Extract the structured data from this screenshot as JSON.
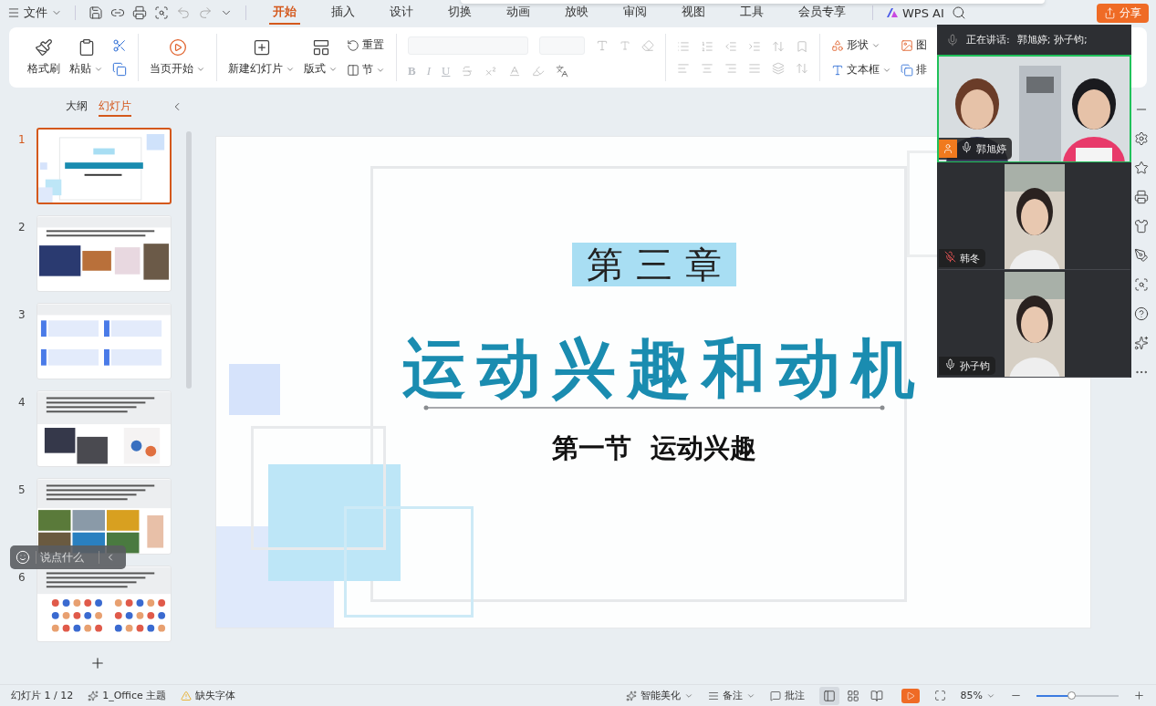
{
  "menu": {
    "label": "文件"
  },
  "ribbon_tabs": [
    {
      "label": "开始",
      "selected": true
    },
    {
      "label": "插入",
      "selected": false
    },
    {
      "label": "设计",
      "selected": false
    },
    {
      "label": "切换",
      "selected": false
    },
    {
      "label": "动画",
      "selected": false
    },
    {
      "label": "放映",
      "selected": false
    },
    {
      "label": "审阅",
      "selected": false
    },
    {
      "label": "视图",
      "selected": false
    },
    {
      "label": "工具",
      "selected": false
    },
    {
      "label": "会员专享",
      "selected": false
    }
  ],
  "ai_button": "WPS AI",
  "share_button": "分享",
  "clipboard": {
    "format_painter": "格式刷",
    "paste": "粘贴"
  },
  "slideshow": {
    "from_current": "当页开始"
  },
  "slides_group": {
    "new_slide": "新建幻灯片",
    "layout": "版式",
    "reset": "重置",
    "section": "节"
  },
  "font_group": {
    "bold": "B",
    "italic": "I",
    "underline": "U"
  },
  "insert_group": {
    "shape": "形状",
    "text_box": "文本框",
    "picture": "图",
    "arrange": "排"
  },
  "panel": {
    "tabs": [
      {
        "label": "大纲",
        "selected": false
      },
      {
        "label": "幻灯片",
        "selected": true
      }
    ],
    "slides": [
      {
        "number": "1",
        "selected": true,
        "kind": "title"
      },
      {
        "number": "2",
        "selected": false,
        "kind": "photos"
      },
      {
        "number": "3",
        "selected": false,
        "kind": "numbered"
      },
      {
        "number": "4",
        "selected": false,
        "kind": "mixed"
      },
      {
        "number": "5",
        "selected": false,
        "kind": "grid"
      },
      {
        "number": "6",
        "selected": false,
        "kind": "icons"
      }
    ]
  },
  "slide": {
    "chapter": "第三章",
    "title": "运动兴趣和动机",
    "subtitle": "第一节  运动兴趣"
  },
  "comment_box": {
    "placeholder": "说点什么"
  },
  "meeting": {
    "speaking_label": "正在讲话:",
    "speakers": "郭旭婷; 孙子钧;",
    "participants": [
      {
        "name": "郭旭婷",
        "muted": false,
        "host": true,
        "selected": true,
        "kind": "pair"
      },
      {
        "name": "韩冬",
        "muted": true,
        "host": false,
        "selected": false,
        "kind": "single"
      },
      {
        "name": "孙子钧",
        "muted": false,
        "host": false,
        "selected": false,
        "kind": "single"
      }
    ]
  },
  "status_bar": {
    "slide_counter": "幻灯片 1 / 12",
    "theme": "1_Office 主题",
    "missing_fonts": "缺失字体",
    "smart_beautify": "智能美化",
    "notes": "备注",
    "comments": "批注",
    "views": [
      {
        "kind": "normal",
        "selected": true
      },
      {
        "kind": "sorter",
        "selected": false
      },
      {
        "kind": "reading",
        "selected": false
      }
    ],
    "zoom": "85%",
    "zoom_slider": {
      "level": 0.42
    }
  }
}
